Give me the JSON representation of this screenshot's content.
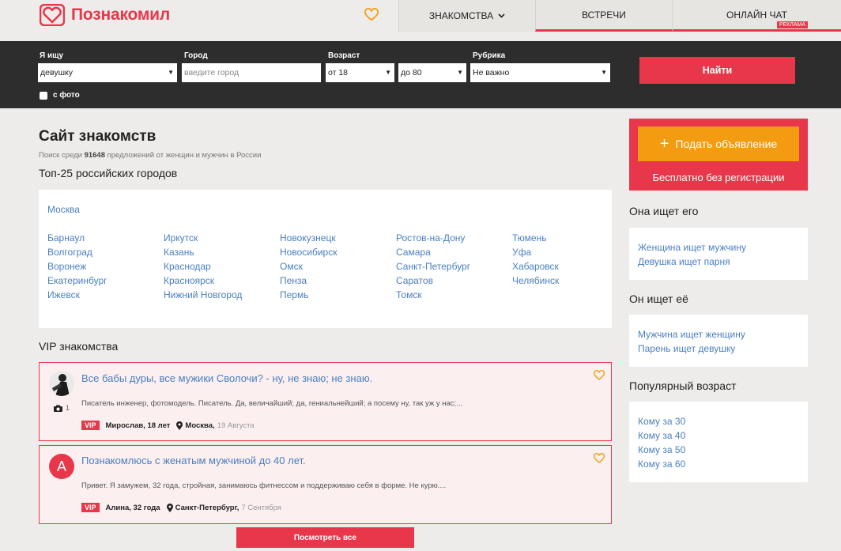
{
  "colors": {
    "brand": "#e8374a",
    "link": "#4a7fc1",
    "orange": "#f39c12",
    "dark": "#2d2d2d"
  },
  "header": {
    "logo_text": "Познакомил",
    "nav": [
      {
        "label": "ЗНАКОМСТВА",
        "has_dropdown": true
      },
      {
        "label": "ВСТРЕЧИ"
      },
      {
        "label": "ОНЛАЙН ЧАТ",
        "badge": "Реклама"
      }
    ]
  },
  "search": {
    "seeking": {
      "label": "Я ищу",
      "value": "девушку"
    },
    "city": {
      "label": "Город",
      "placeholder": "введите город"
    },
    "age": {
      "label": "Возраст",
      "from": "от 18",
      "to": "до 80"
    },
    "category": {
      "label": "Рубрика",
      "value": "Не важно"
    },
    "find_button": "Найти",
    "photo_checkbox": "с фото"
  },
  "main": {
    "title": "Сайт знакомств",
    "subtitle_prefix": "Поиск среди ",
    "subtitle_count": "91648",
    "subtitle_suffix": " предложений от женщин и мужчин в России",
    "top_cities_title": "Топ-25 российских городов",
    "top_city": "Москва",
    "city_columns": [
      [
        "Барнаул",
        "Волгоград",
        "Воронеж",
        "Екатеринбург",
        "Ижевск"
      ],
      [
        "Иркутск",
        "Казань",
        "Краснодар",
        "Красноярск",
        "Нижний Новгород"
      ],
      [
        "Новокузнецк",
        "Новосибирск",
        "Омск",
        "Пенза",
        "Пермь"
      ],
      [
        "Ростов-на-Дону",
        "Самара",
        "Санкт-Петербург",
        "Саратов",
        "Томск"
      ],
      [
        "Тюмень",
        "Уфа",
        "Хабаровск",
        "Челябинск"
      ]
    ],
    "vip_title": "VIP знакомства",
    "vip_cards": [
      {
        "title": "Все бабы дуры, все мужики Сволочи? - ну, не знаю; не знаю.",
        "text": "Писатель инженер, фотомодель. Писатель. Да, величайший; да, гениальнейший; а посему ну, так уж у нас;...",
        "vip": "VIP",
        "author": "Мирослав, 18 лет",
        "city": "Москва,",
        "date": "19 Августа",
        "photo_count": "1"
      },
      {
        "title": "Познакомлюсь с женатым мужчиной до 40 лет.",
        "text": "Привет. Я замужем, 32 года, стройная, занимаюсь фитнессом и поддерживаю себя в форме. Не курю....",
        "vip": "VIP",
        "author": "Алина, 32 года",
        "city": "Санкт-Петербург,",
        "date": "7 Сентября",
        "avatar_letter": "A"
      }
    ],
    "see_all_button": "Посмотреть все"
  },
  "sidebar": {
    "post_button": "Подать объявление",
    "post_sub": "Бесплатно без регистрации",
    "she_seeks": {
      "title": "Она ищет его",
      "links": [
        "Женщина ищет мужчину",
        "Девушка ищет парня"
      ]
    },
    "he_seeks": {
      "title": "Он ищет её",
      "links": [
        "Мужчина ищет женщину",
        "Парень ищет девушку"
      ]
    },
    "popular_age": {
      "title": "Популярный возраст",
      "links": [
        "Кому за 30",
        "Кому за 40",
        "Кому за 50",
        "Кому за 60"
      ]
    }
  }
}
